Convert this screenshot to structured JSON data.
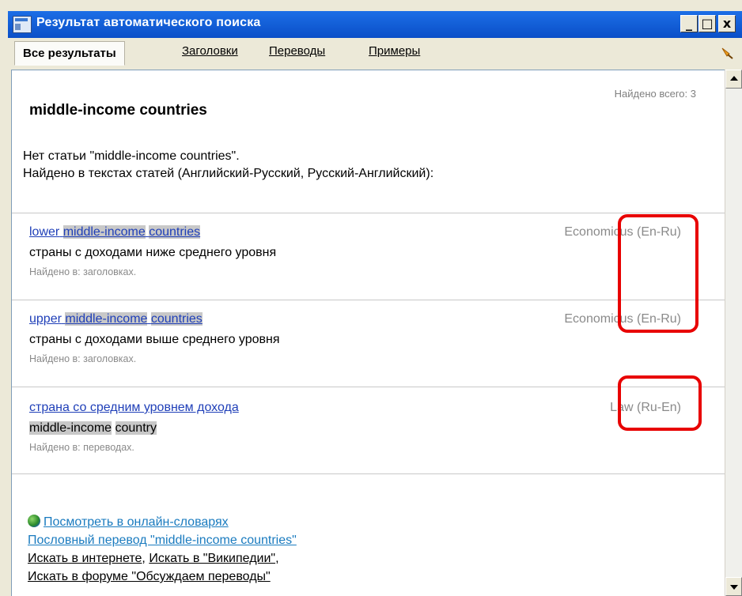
{
  "window": {
    "title": "Результат автоматического поиска",
    "controls": {
      "minimize": "_",
      "maximize": "□",
      "close": "x"
    }
  },
  "tabs": [
    {
      "label": "Все результаты",
      "active": true
    },
    {
      "label": "Заголовки"
    },
    {
      "label": "Переводы"
    },
    {
      "label": "Примеры"
    }
  ],
  "content": {
    "found_total": "Найдено всего: 3",
    "headword": "middle-income countries",
    "note_line1": "Нет статьи \"middle-income countries\".",
    "note_line2": "Найдено в текстах статей (Английский-Русский, Русский-Английский):",
    "entries": [
      {
        "head_a": "lower",
        "head_b": "middle-income",
        "head_c": "countries",
        "source": "Economicus",
        "direction": "(En-Ru)",
        "translation": "страны с доходами ниже среднего уровня",
        "found_in": "Найдено в: заголовках."
      },
      {
        "head_a": "upper",
        "head_b": "middle-income",
        "head_c": "countries",
        "source": "Economicus",
        "direction": "(En-Ru)",
        "translation": "страны с доходами выше среднего уровня",
        "found_in": "Найдено в: заголовках."
      },
      {
        "head": "страна со средним уровнем дохода",
        "source": "Law",
        "direction": "(Ru-En)",
        "translation_a": "middle-income",
        "translation_b": "country",
        "found_in": "Найдено в: переводах."
      }
    ],
    "links": {
      "online": "Посмотреть в онлайн-словарях",
      "wordbyword": "Пословный перевод \"middle-income countries\"",
      "internet": "Искать в интернете",
      "wiki": "Искать в \"Википедии\"",
      "forum": "Искать в форуме \"Обсуждаем переводы\""
    }
  },
  "colors": {
    "title_bar": "#0a4fc8",
    "link": "#1f3fb8",
    "highlight": "#c8c8c8",
    "annotation": "#e80000"
  },
  "icons": [
    "window-icon",
    "pin-icon",
    "globe-icon"
  ]
}
